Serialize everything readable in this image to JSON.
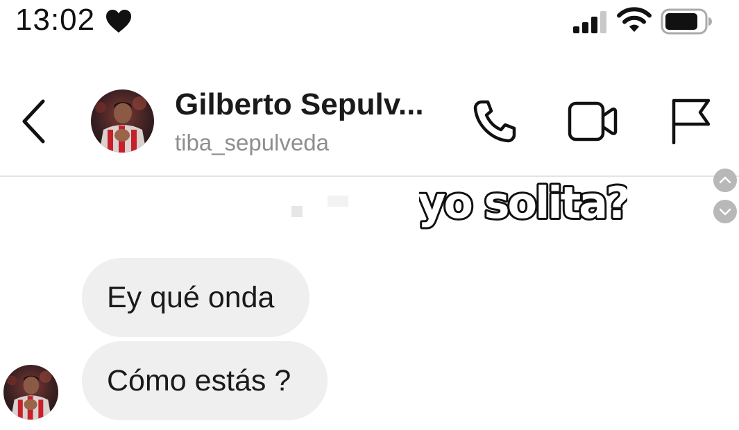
{
  "status_bar": {
    "time": "13:02",
    "heart_icon": "heart-icon",
    "signal_icon": "cellular-signal-icon",
    "wifi_icon": "wifi-icon",
    "battery_icon": "battery-icon"
  },
  "header": {
    "name": "Gilberto Sepulv...",
    "username": "tiba_sepulveda",
    "back_icon": "chevron-left-icon",
    "call_icon": "phone-icon",
    "video_icon": "video-camera-icon",
    "flag_icon": "flag-icon"
  },
  "sticker": {
    "text": "yo solita?"
  },
  "messages": [
    {
      "text": "Ey qué onda"
    },
    {
      "text": "Cómo estás ?"
    }
  ],
  "colors": {
    "bubble_background": "#efefef",
    "username": "#8e8e8e",
    "divider": "#e3e3e3",
    "scroll_button": "#b8b8b8"
  }
}
